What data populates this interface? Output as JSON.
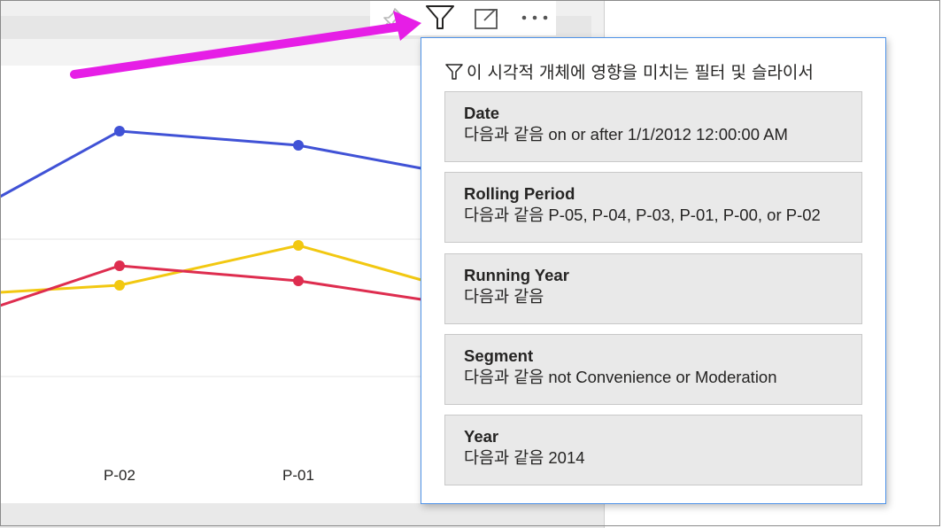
{
  "visual": {
    "x_axis_labels": [
      "P-02",
      "P-01"
    ],
    "series_colors": {
      "blue": "#4052d6",
      "yellow": "#f2c811",
      "red": "#de2d4f"
    },
    "header_icons": [
      "pin-icon",
      "filter-icon",
      "focus-mode-icon",
      "more-options-icon"
    ]
  },
  "filter_popup": {
    "title": "이 시각적 개체에 영향을 미치는 필터 및 슬라이서",
    "filters": [
      {
        "name": "Date",
        "value": "다음과 같음 on or after 1/1/2012 12:00:00 AM"
      },
      {
        "name": "Rolling Period",
        "value": "다음과 같음 P-05, P-04, P-03, P-01, P-00, or P-02"
      },
      {
        "name": "Running Year",
        "value": "다음과 같음"
      },
      {
        "name": "Segment",
        "value": "다음과 같음 not Convenience or Moderation"
      },
      {
        "name": "Year",
        "value": "다음과 같음 2014"
      }
    ]
  },
  "annotation": {
    "arrow_color": "#e61ee6"
  },
  "colors": {
    "popup_border": "#4f93e8",
    "card_bg": "#e9e9e9"
  }
}
